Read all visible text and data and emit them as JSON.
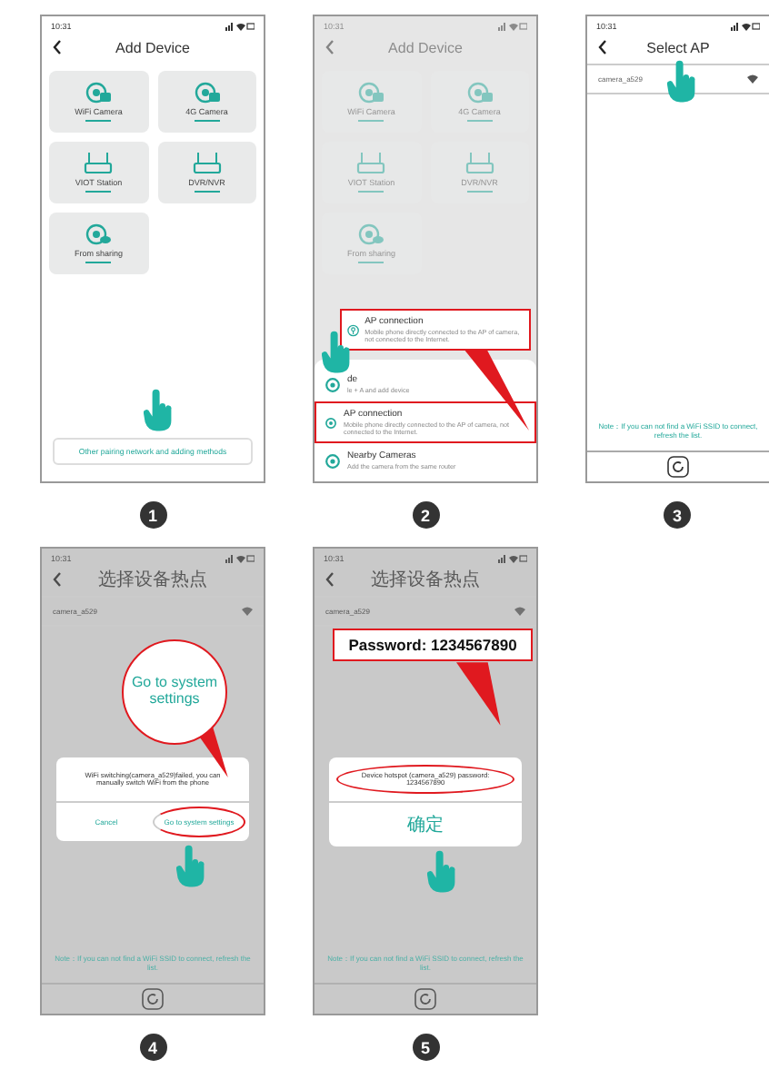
{
  "steps": [
    {
      "number": "1",
      "kind": "add_device",
      "dimmed": false,
      "time": "10:31",
      "title": "Add Device",
      "tiles": [
        {
          "kind": "camera",
          "label": "WiFi Camera"
        },
        {
          "kind": "camera",
          "label": "4G Camera"
        },
        {
          "kind": "station",
          "label": "VIOT Station"
        },
        {
          "kind": "station",
          "label": "DVR/NVR"
        },
        {
          "kind": "share",
          "label": "From sharing"
        }
      ],
      "bottom_button": "Other pairing network and adding methods"
    },
    {
      "number": "2",
      "kind": "add_device",
      "dimmed": true,
      "time": "10:31",
      "title": "Add Device",
      "tiles": [
        {
          "kind": "camera",
          "label": "WiFi Camera"
        },
        {
          "kind": "camera",
          "label": "4G Camera"
        },
        {
          "kind": "station",
          "label": "VIOT Station"
        },
        {
          "kind": "station",
          "label": "DVR/NVR"
        },
        {
          "kind": "share",
          "label": "From sharing"
        }
      ],
      "sheet": [
        {
          "title": "de",
          "text": "le + A and add device",
          "highlighted": false
        },
        {
          "title": "AP connection",
          "text": "Mobile phone directly connected to the AP of camera, not connected to the Internet.",
          "highlighted": true
        },
        {
          "title": "Nearby Cameras",
          "text": "Add the camera from the same router",
          "highlighted": false
        }
      ],
      "callout": {
        "kind": "box",
        "title": "AP connection",
        "text": "Mobile phone directly connected to the AP of camera, not connected to the Internet."
      }
    },
    {
      "number": "3",
      "kind": "ap_list",
      "dimmed": false,
      "time": "10:31",
      "title": "Select AP",
      "networks": [
        "camera_a529"
      ],
      "note": "Note：If you can not find a WiFi SSID to connect, refresh the list."
    },
    {
      "number": "4",
      "kind": "ap_list",
      "dimmed": true,
      "time": "10:31",
      "title": "选择设备热点",
      "networks": [
        "camera_a529"
      ],
      "note": "Note：If you can not find a WiFi SSID to connect, refresh the list.",
      "dialog": {
        "message": "WiFi switching(camera_a529)failed, you can manually switch WiFi from the phone",
        "buttons": [
          {
            "label": "Cancel",
            "highlighted": false
          },
          {
            "label": "Go to system settings",
            "highlighted": true
          }
        ],
        "message_highlighted": false
      },
      "callout": {
        "kind": "circle",
        "text": "Go to system settings"
      }
    },
    {
      "number": "5",
      "kind": "ap_list",
      "dimmed": true,
      "time": "10:31",
      "title": "选择设备热点",
      "networks": [
        "camera_a529"
      ],
      "note": "Note：If you can not find a WiFi SSID to connect, refresh the list.",
      "dialog": {
        "message": "Device hotspot (camera_a529) password: 1234567890",
        "buttons": [
          {
            "label": "确定",
            "highlighted": false
          }
        ],
        "message_highlighted": true
      },
      "callout": {
        "kind": "banner",
        "text": "Password: 1234567890"
      }
    }
  ]
}
